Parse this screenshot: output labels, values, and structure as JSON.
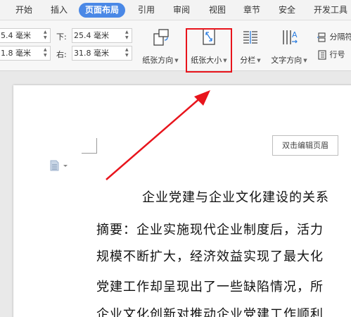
{
  "tabs": [
    {
      "label": "开始",
      "active": false
    },
    {
      "label": "插入",
      "active": false
    },
    {
      "label": "页面布局",
      "active": true
    },
    {
      "label": "引用",
      "active": false
    },
    {
      "label": "审阅",
      "active": false
    },
    {
      "label": "视图",
      "active": false
    },
    {
      "label": "章节",
      "active": false
    },
    {
      "label": "安全",
      "active": false
    },
    {
      "label": "开发工具",
      "active": false
    }
  ],
  "margins": {
    "top_value": "5.4 毫米",
    "bottom_value": "1.8 毫米",
    "down_label": "下:",
    "down_value": "25.4 毫米",
    "right_label": "右:",
    "right_value": "31.8 毫米"
  },
  "ribbon": {
    "orientation_label": "纸张方向",
    "size_label": "纸张大小",
    "columns_label": "分栏",
    "text_direction_label": "文字方向",
    "separator_label": "分隔符",
    "line_number_label": "行号"
  },
  "document": {
    "header_button": "双击编辑页眉",
    "lines": [
      "企业党建与企业文化建设的关系",
      "摘要：企业实施现代企业制度后，活力",
      "规模不断扩大，经济效益实现了最大化",
      "党建工作却呈现出了一些缺陷情况，所",
      "企业文化创新对推动企业党建工作顺利"
    ]
  },
  "colors": {
    "active_tab": "#4a88e6",
    "highlight_box": "#e8141c",
    "arrow": "#e8141c"
  },
  "icons": [
    "orientation-icon",
    "paper-size-icon",
    "columns-icon",
    "text-direction-icon",
    "separator-icon",
    "line-number-icon",
    "document-icon",
    "chevron-down-icon"
  ]
}
